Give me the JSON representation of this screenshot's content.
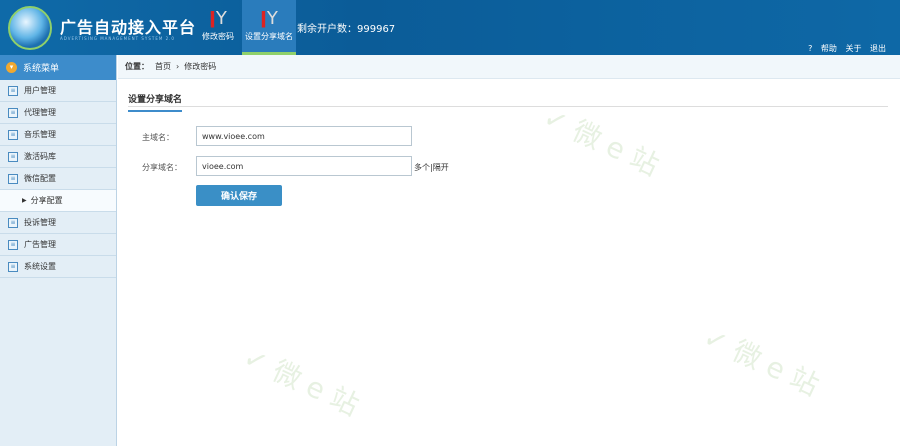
{
  "header": {
    "title": "广告自动接入平台",
    "subtitle": "ADVERTISING MANAGEMENT SYSTEM 2.0",
    "nav": [
      {
        "label": "修改密码"
      },
      {
        "label": "设置分享域名"
      }
    ],
    "count_label": "剩余开户数：999967",
    "links": {
      "help": "帮助",
      "about": "关于",
      "logout": "退出"
    }
  },
  "sidebar": {
    "title": "系统菜单",
    "items": [
      {
        "label": "用户管理"
      },
      {
        "label": "代理管理"
      },
      {
        "label": "音乐管理"
      },
      {
        "label": "激活码库"
      },
      {
        "label": "微信配置"
      },
      {
        "label": "分享配置"
      },
      {
        "label": "投诉管理"
      },
      {
        "label": "广告管理"
      },
      {
        "label": "系统设置"
      }
    ]
  },
  "breadcrumb": {
    "prefix": "位置：",
    "home": "首页",
    "sep": "›",
    "current": "修改密码"
  },
  "form": {
    "tab": "设置分享域名",
    "main_label": "主域名：",
    "main_value": "www.vioee.com",
    "share_label": "分享域名：",
    "share_value": "vioee.com",
    "hint": "多个|隔开",
    "save": "确认保存"
  }
}
